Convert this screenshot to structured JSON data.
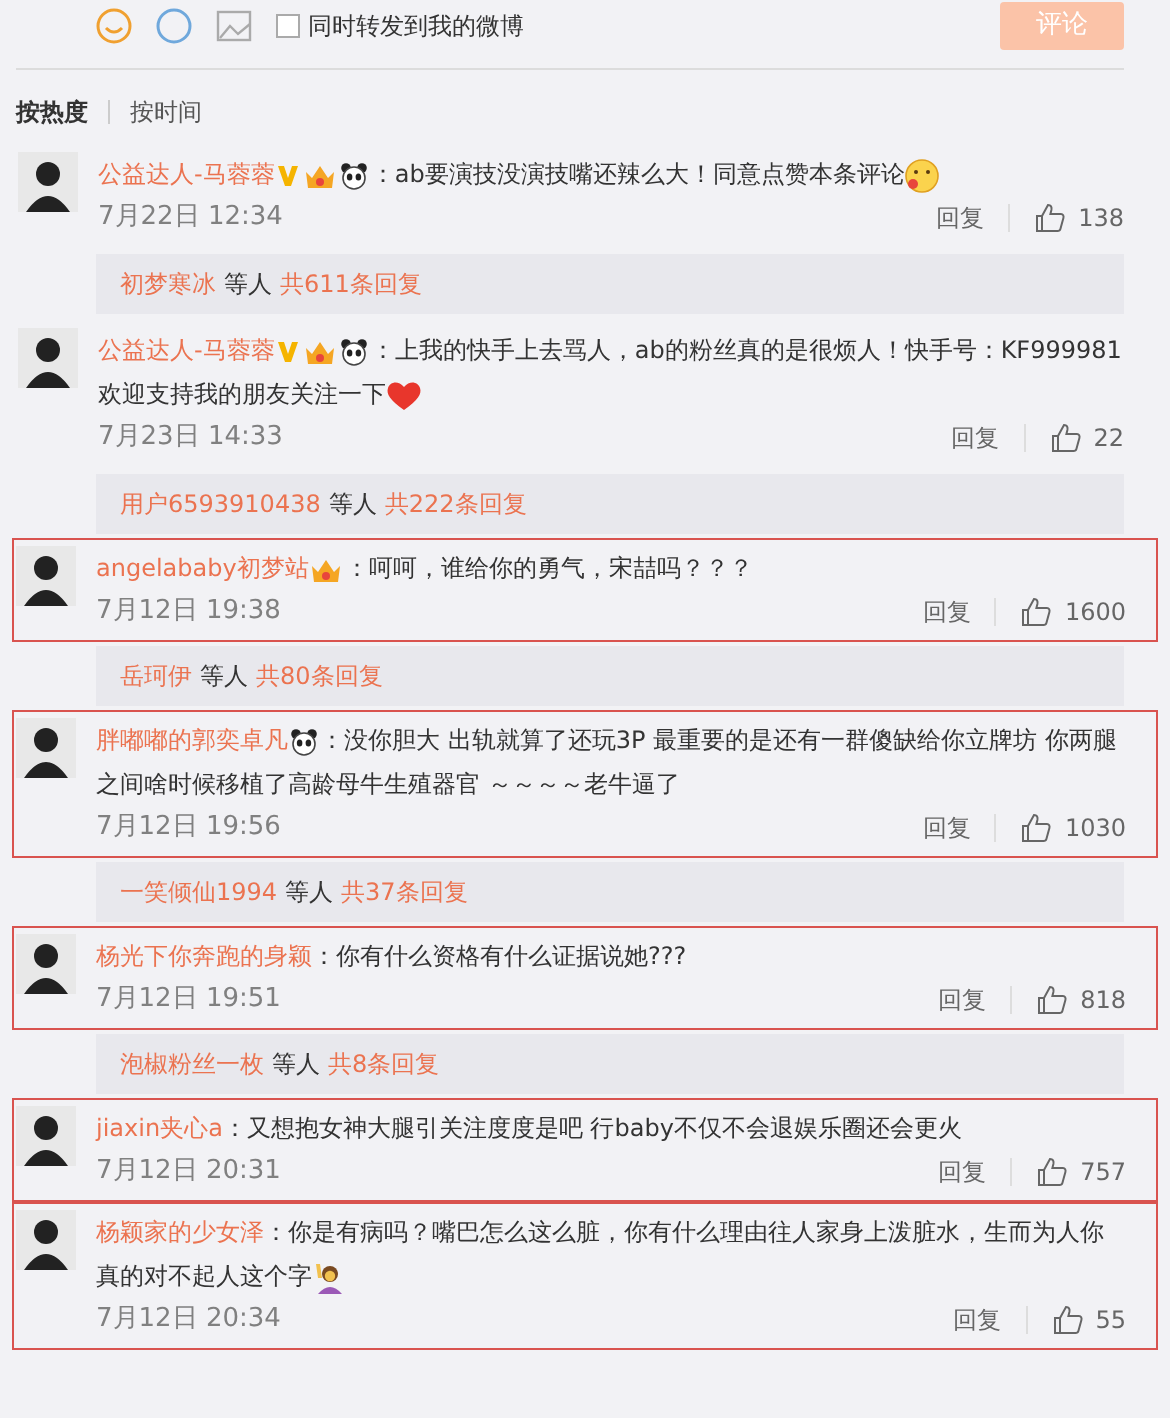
{
  "composer": {
    "share_checkbox": {
      "label": "同时转发到我的微博",
      "checked": false
    },
    "submit": "评论"
  },
  "sort_tabs": [
    {
      "label": "按热度",
      "selected": true
    },
    {
      "label": "按时间",
      "selected": false
    }
  ],
  "comments": [
    {
      "user": "公益达人-马蓉蓉",
      "badges": [
        {
          "kind": "verified"
        },
        {
          "kind": "crown"
        },
        {
          "kind": "panda"
        }
      ],
      "text": "：ab要演技没演技嘴还辣么大！同意点赞本条评论",
      "emoji": {
        "kind": "blush"
      },
      "time": "7月22日 12:34",
      "reply": "回复",
      "likes": "138",
      "highlighted": false,
      "replies": {
        "user": "初梦寒冰",
        "middle": "等人",
        "count": "共611条回复"
      }
    },
    {
      "user": "公益达人-马蓉蓉",
      "badges": [
        {
          "kind": "verified"
        },
        {
          "kind": "crown"
        },
        {
          "kind": "panda"
        }
      ],
      "text": "：上我的快手上去骂人，ab的粉丝真的是很烦人！快手号：KF999981 欢迎支持我的朋友关注一下",
      "emoji": {
        "kind": "heart"
      },
      "time": "7月23日 14:33",
      "reply": "回复",
      "likes": "22",
      "highlighted": false,
      "replies": {
        "user": "用户6593910438",
        "middle": "等人",
        "count": "共222条回复"
      }
    },
    {
      "user": "angelababy初梦站",
      "badges": [
        {
          "kind": "crown"
        }
      ],
      "text": "：呵呵，谁给你的勇气，宋喆吗？？？",
      "time": "7月12日 19:38",
      "reply": "回复",
      "likes": "1600",
      "highlighted": true,
      "replies": {
        "user": "岳珂伊",
        "middle": "等人",
        "count": "共80条回复"
      }
    },
    {
      "user": "胖嘟嘟的郭奕卓凡",
      "badges": [
        {
          "kind": "panda"
        }
      ],
      "text": "：没你胆大 出轨就算了还玩3P 最重要的是还有一群傻缺给你立牌坊 你两腿之间啥时候移植了高龄母牛生殖器官 ～～～～老牛逼了",
      "time": "7月12日 19:56",
      "reply": "回复",
      "likes": "1030",
      "highlighted": true,
      "replies": {
        "user": "一笑倾仙1994",
        "middle": "等人",
        "count": "共37条回复"
      }
    },
    {
      "user": "杨光下你奔跑的身颖",
      "text": "：你有什么资格有什么证据说她???",
      "time": "7月12日 19:51",
      "reply": "回复",
      "likes": "818",
      "highlighted": true,
      "replies": {
        "user": "泡椒粉丝一枚",
        "middle": "等人",
        "count": "共8条回复"
      }
    },
    {
      "user": "jiaxin夹心a",
      "text": "：又想抱女神大腿引关注度度是吧 行baby不仅不会退娱乐圈还会更火",
      "time": "7月12日 20:31",
      "reply": "回复",
      "likes": "757",
      "highlighted": true
    },
    {
      "user": "杨颖家的少女泽",
      "text": "：你是有病吗？嘴巴怎么这么脏，你有什么理由往人家身上泼脏水，生而为人你真的对不起人这个字",
      "emoji": {
        "kind": "person"
      },
      "time": "7月12日 20:34",
      "reply": "回复",
      "likes": "55",
      "highlighted": true
    }
  ]
}
